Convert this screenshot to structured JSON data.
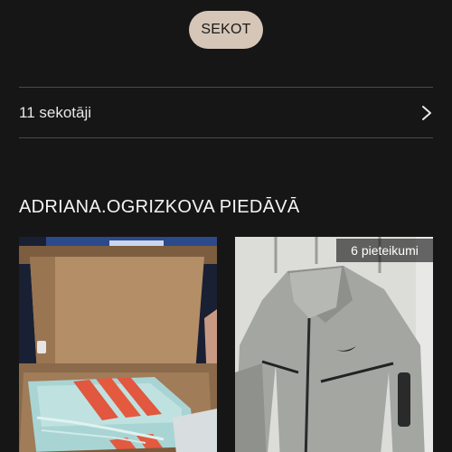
{
  "profile": {
    "follow_label": "SEKOT",
    "followers_label": "11 sekotāji"
  },
  "listings": {
    "title": "ADRIANA.OGRIZKOVA PIEDĀVĀ",
    "items": [
      {
        "image": "sneakers-in-box",
        "badge": ""
      },
      {
        "image": "grey-nike-hoodie",
        "badge": "6 pieteikumi"
      }
    ]
  },
  "colors": {
    "background": "#161616",
    "follow_button": "#d6c6b8",
    "divider": "#4a4a4a"
  },
  "icons": {
    "followers_chevron": "chevron-right-icon"
  }
}
